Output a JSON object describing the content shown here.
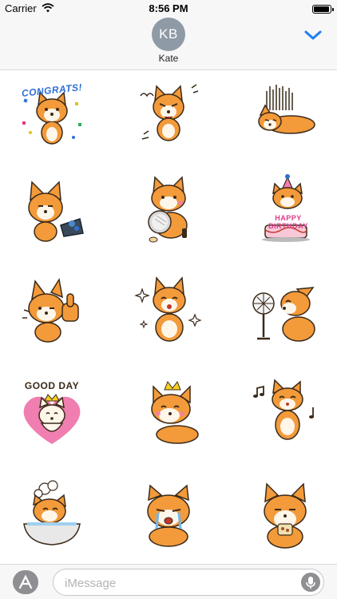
{
  "status_bar": {
    "carrier": "Carrier",
    "time": "8:56 PM",
    "battery_level": 0.95
  },
  "header": {
    "avatar_initials": "KB",
    "contact_name": "Kate"
  },
  "stickers": [
    {
      "name": "corgi-congrats",
      "caption": "CONGRATS!"
    },
    {
      "name": "corgi-angry"
    },
    {
      "name": "corgi-depressed"
    },
    {
      "name": "corgi-trash"
    },
    {
      "name": "corgi-mirror"
    },
    {
      "name": "corgi-birthday",
      "caption": "HAPPY BIRTHDAY"
    },
    {
      "name": "corgi-thumbs-up"
    },
    {
      "name": "corgi-sparkle"
    },
    {
      "name": "corgi-fan"
    },
    {
      "name": "corgi-good-day",
      "caption": "GOOD DAY"
    },
    {
      "name": "corgi-crown"
    },
    {
      "name": "corgi-music"
    },
    {
      "name": "corgi-bath"
    },
    {
      "name": "corgi-crying"
    },
    {
      "name": "corgi-eating"
    }
  ],
  "message_bar": {
    "placeholder": "iMessage"
  },
  "colors": {
    "accent": "#1f7ef5",
    "corgi_orange": "#f39a3a",
    "corgi_cream": "#fff6ea",
    "heart_pink": "#f07eb0",
    "avatar_gray": "#8e9aa5"
  },
  "icons": {
    "wifi": "wifi-icon",
    "battery": "battery-icon",
    "collapse": "chevron-down-icon",
    "apps": "app-store-icon",
    "mic": "microphone-icon"
  }
}
